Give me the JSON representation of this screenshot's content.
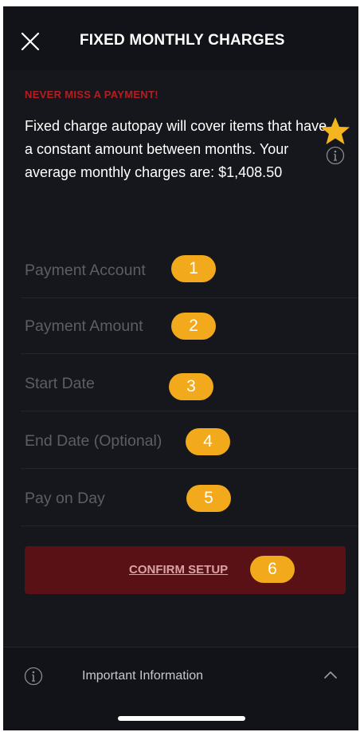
{
  "header": {
    "title": "FIXED MONTHLY CHARGES",
    "close_icon": "close-icon"
  },
  "alert": {
    "title": "NEVER MISS A PAYMENT!",
    "description": "Fixed charge autopay will cover items that have a constant amount between months. Your average monthly charges are: $1,408.50",
    "star_icon": "star-icon",
    "info_icon": "info-icon"
  },
  "form": {
    "fields": [
      {
        "label": "Payment Account",
        "badge": "1"
      },
      {
        "label": "Payment Amount",
        "badge": "2"
      },
      {
        "label": "Start Date",
        "badge": "3"
      },
      {
        "label": "End Date (Optional)",
        "badge": "4"
      },
      {
        "label": "Pay on Day",
        "badge": "5"
      }
    ],
    "confirm_label": "CONFIRM SETUP",
    "confirm_badge": "6"
  },
  "footer": {
    "label": "Important Information",
    "info_icon": "info-icon",
    "chevron_icon": "chevron-up-icon"
  },
  "colors": {
    "background": "#16171c",
    "alert_red": "#b51d21",
    "button_bg": "#5a1116",
    "badge_orange": "#f2a91b",
    "star_gold": "#f5b51e"
  }
}
